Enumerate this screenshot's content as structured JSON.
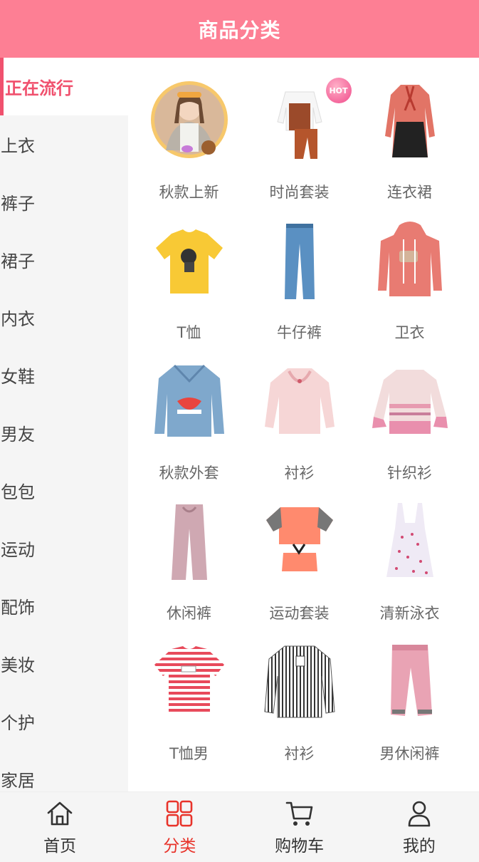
{
  "header": {
    "title": "商品分类"
  },
  "sidebar": {
    "items": [
      {
        "label": "正在流行",
        "active": true
      },
      {
        "label": "上衣"
      },
      {
        "label": "裤子"
      },
      {
        "label": "裙子"
      },
      {
        "label": "内衣"
      },
      {
        "label": "女鞋"
      },
      {
        "label": "男友"
      },
      {
        "label": "包包"
      },
      {
        "label": "运动"
      },
      {
        "label": "配饰"
      },
      {
        "label": "美妆"
      },
      {
        "label": "个护"
      },
      {
        "label": "家居"
      }
    ]
  },
  "grid": {
    "items": [
      {
        "label": "秋款上新",
        "icon": "girl-portrait-image"
      },
      {
        "label": "时尚套装",
        "icon": "outfit-set-image",
        "badge": "HOT"
      },
      {
        "label": "连衣裙",
        "icon": "dress-image"
      },
      {
        "label": "T恤",
        "icon": "yellow-tshirt-image"
      },
      {
        "label": "牛仔裤",
        "icon": "jeans-image"
      },
      {
        "label": "卫衣",
        "icon": "hoodie-image"
      },
      {
        "label": "秋款外套",
        "icon": "denim-jacket-image"
      },
      {
        "label": "衬衫",
        "icon": "pink-blouse-image"
      },
      {
        "label": "针织衫",
        "icon": "knit-sweater-image"
      },
      {
        "label": "休闲裤",
        "icon": "casual-pants-image"
      },
      {
        "label": "运动套装",
        "icon": "sport-set-image"
      },
      {
        "label": "清新泳衣",
        "icon": "swimsuit-image"
      },
      {
        "label": "T恤男",
        "icon": "striped-tshirt-image"
      },
      {
        "label": "衬衫",
        "icon": "striped-shirt-image"
      },
      {
        "label": "男休闲裤",
        "icon": "mens-pants-image"
      }
    ]
  },
  "tabbar": {
    "items": [
      {
        "label": "首页",
        "icon": "home-icon"
      },
      {
        "label": "分类",
        "icon": "category-icon",
        "active": true
      },
      {
        "label": "购物车",
        "icon": "cart-icon"
      },
      {
        "label": "我的",
        "icon": "user-icon"
      }
    ]
  },
  "colors": {
    "accent": "#fd7f94",
    "active_text": "#f0516e",
    "tab_active": "#e8332a"
  }
}
